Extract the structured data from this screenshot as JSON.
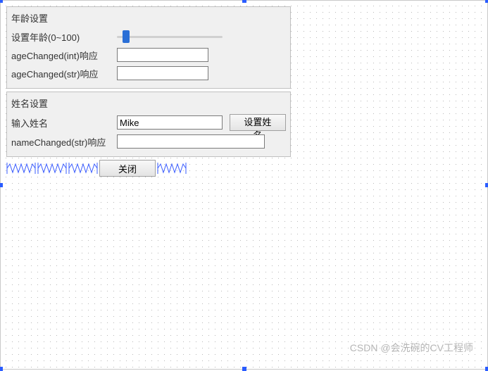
{
  "ageGroup": {
    "title": "年龄设置",
    "sliderLabel": "设置年龄(0~100)",
    "sliderValue": 5,
    "sliderMin": 0,
    "sliderMax": 100,
    "ageIntLabel": "ageChanged(int)响应",
    "ageIntValue": "",
    "ageStrLabel": "ageChanged(str)响应",
    "ageStrValue": ""
  },
  "nameGroup": {
    "title": "姓名设置",
    "inputLabel": "输入姓名",
    "inputValue": "Mike",
    "setButton": "设置姓名",
    "nameStrLabel": "nameChanged(str)响应",
    "nameStrValue": ""
  },
  "bottom": {
    "closeButton": "关闭"
  },
  "watermark": "CSDN @会洗碗的CV工程师"
}
